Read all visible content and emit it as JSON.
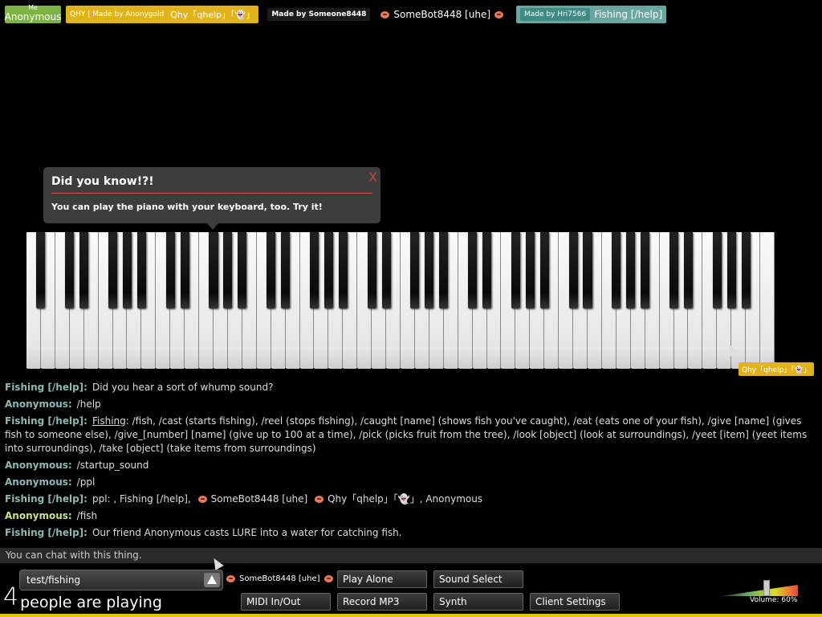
{
  "userbar": {
    "me_label": "Me",
    "me_name": "Anonymous",
    "qhy_pill": "QHY | Made by Anonygold",
    "qhy_name": "Qhy「qhelp」「👻」",
    "somebot_pill": "Made by Someone8448",
    "somebot_name": "SomeBot8448 [uhe]",
    "fish_pill": "Made by Hri7566",
    "fish_name": "Fishing [/help]"
  },
  "tip": {
    "title": "Did you know!?!",
    "body": "You can play the piano with your keyboard, too. Try it!",
    "close": "X"
  },
  "cursor_label": "Qhy「qhelp」「👻」",
  "chat": {
    "messages": [
      {
        "who": "Fishing [/help]:",
        "text": "Did you hear a sort of whump sound?"
      },
      {
        "who": "Anonymous:",
        "text": "/help"
      },
      {
        "who": "Fishing [/help]:",
        "u": "Fishing",
        "text": ": /fish, /cast (starts fishing), /reel (stops fishing), /caught [name] (shows fish you've caught), /eat (eats one of your fish), /give [name] (gives fish to someone else), /give_[number] [name] (give up to 100 at a time), /pick (picks fruit from the tree), /look [object] (look at surroundings), /yeet [item] (yeet items into surroundings), /take [object] (take items from surroundings)"
      },
      {
        "who": "Anonymous:",
        "text": "/startup_sound"
      },
      {
        "who": "Anonymous:",
        "text": "/ppl"
      },
      {
        "who": "Fishing [/help]:",
        "text_a": "ppl: , Fishing [/help],",
        "text_b": "SomeBot8448 [uhe]",
        "text_c": "Qhy「qhelp」「👻」, Anonymous"
      },
      {
        "who": "Anonymous:",
        "text": "/fish"
      },
      {
        "who": "Fishing [/help]:",
        "text": "Our friend Anonymous casts LURE into a water for catching fish."
      }
    ],
    "input_placeholder": "You can chat with this thing."
  },
  "controls": {
    "room_name": "test/fishing",
    "count": "4",
    "count_text": "people are playing",
    "owner": "SomeBot8448 [uhe]",
    "buttons": {
      "play_alone": "Play Alone",
      "sound_select": "Sound Select",
      "midi": "MIDI In/Out",
      "record": "Record MP3",
      "synth": "Synth",
      "client_settings": "Client Settings"
    },
    "volume_text": "Volume: 60%",
    "volume_level": 0.6
  },
  "colors": {
    "me": "#7cb342",
    "qhy": "#e0b31a",
    "fishing": "#6aa6a0",
    "accent_red": "#d9553d"
  }
}
